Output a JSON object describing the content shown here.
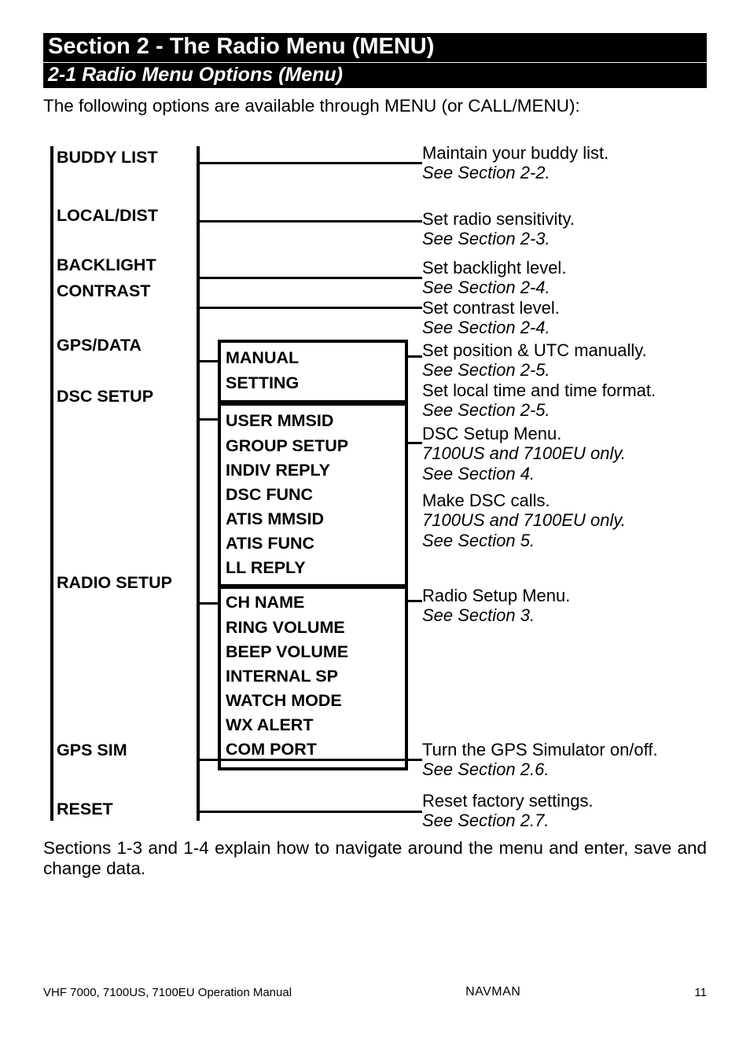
{
  "section_title": "Section 2 - The Radio Menu (MENU)",
  "subsection_title": "2-1 Radio Menu Options (Menu)",
  "intro_text": "The following options are available through MENU (or CALL/MENU):",
  "menu": {
    "buddy_list": "BUDDY LIST",
    "local_dist": "LOCAL/DIST",
    "backlight": "BACKLIGHT",
    "contrast": "CONTRAST",
    "gps_data": "GPS/DATA",
    "dsc_setup": "DSC SETUP",
    "radio_setup": "RADIO SETUP",
    "gps_sim": "GPS SIM",
    "reset": "RESET"
  },
  "gps_sub": {
    "manual": "MANUAL",
    "setting": "SETTING"
  },
  "dsc_sub": {
    "user_mmsid": "USER MMSID",
    "group_setup": "GROUP SETUP",
    "indiv_reply": "INDIV REPLY",
    "dsc_func": "DSC FUNC",
    "atis_mmsid": "ATIS MMSID",
    "atis_func": "ATIS FUNC",
    "ll_reply": "LL REPLY"
  },
  "radio_sub": {
    "ch_name": "CH NAME",
    "ring_volume": "RING VOLUME",
    "beep_volume": "BEEP VOLUME",
    "internal_sp": "INTERNAL SP",
    "watch_mode": "WATCH MODE",
    "wx_alert": "WX ALERT",
    "com_port": "COM PORT"
  },
  "desc": {
    "buddy": {
      "text": "Maintain your buddy list.",
      "ref": "See Section 2-2."
    },
    "local": {
      "text": "Set radio sensitivity.",
      "ref": "See Section 2-3."
    },
    "backlight": {
      "text": "Set backlight level.",
      "ref": "See Section 2-4."
    },
    "contrast": {
      "text": "Set contrast level.",
      "ref": "See Section 2-4."
    },
    "gps1": {
      "text": "Set position & UTC manually.",
      "ref": "See Section 2-5."
    },
    "gps2": {
      "text": "Set local time and time format.",
      "ref": "See Section 2-5."
    },
    "dsc1": {
      "text": "DSC Setup Menu.",
      "note": "7100US and 7100EU only.",
      "ref": "See Section 4."
    },
    "dsc2": {
      "text": "Make DSC calls.",
      "note": "7100US and 7100EU only.",
      "ref": "See Section 5."
    },
    "radio": {
      "text": "Radio Setup Menu.",
      "ref": "See Section 3."
    },
    "gpssim": {
      "text": "Turn the GPS Simulator on/off.",
      "ref": "See Section 2.6."
    },
    "reset": {
      "text": "Reset factory settings.",
      "ref": "See Section 2.7."
    }
  },
  "outro_text": "Sections 1-3 and 1-4 explain how to navigate around the menu and enter, save and change data.",
  "footer": {
    "left": "VHF 7000, 7100US, 7100EU Operation Manual",
    "center": "NAVMAN",
    "right": "11"
  }
}
